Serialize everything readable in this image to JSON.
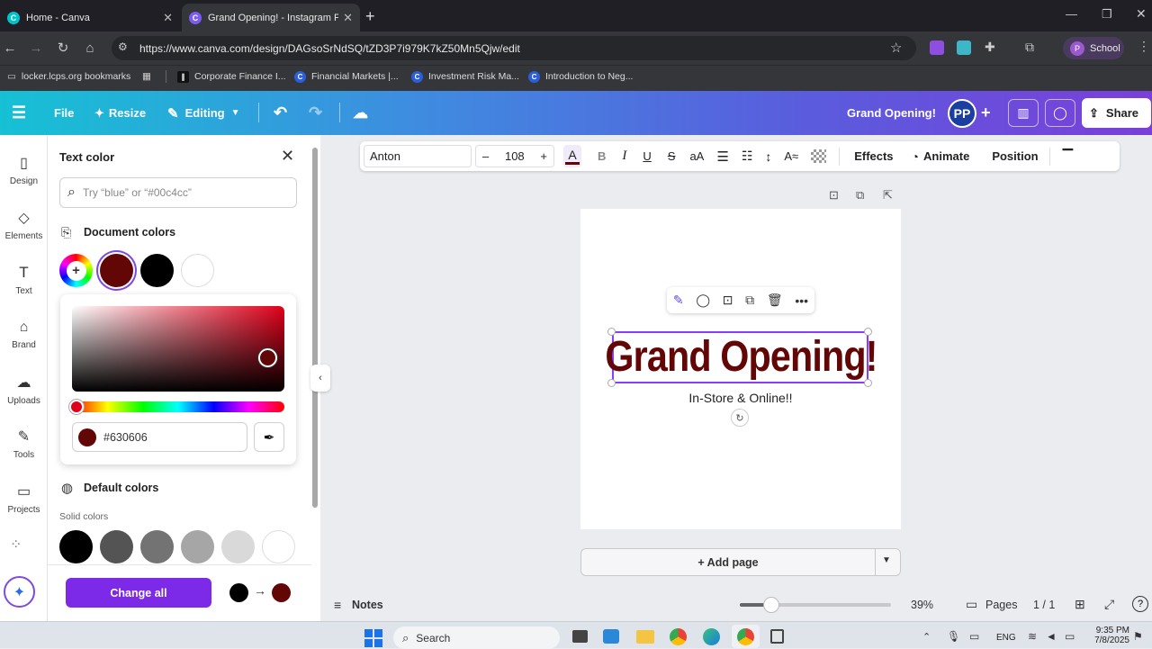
{
  "browser": {
    "tabs": [
      {
        "label": "Home - Canva",
        "close": "✕"
      },
      {
        "label": "Grand Opening! - Instagram Po",
        "close": "✕"
      }
    ],
    "new_tab": "+",
    "url": "https://www.canva.com/design/DAGsoSrNdSQ/tZD3P7i979K7kZ50Mn5Qjw/edit",
    "profile": "School",
    "profile_initial": "P",
    "bookmarks": [
      "locker.lcps.org bookmarks",
      "Corporate Finance I...",
      "Financial Markets |...",
      "Investment Risk Ma...",
      "Introduction to Neg..."
    ]
  },
  "topbar": {
    "file": "File",
    "resize": "Resize",
    "editing": "Editing",
    "title": "Grand Opening!",
    "avatar": "PP",
    "share": "Share"
  },
  "rail": [
    {
      "label": "Design",
      "icon": "panel-icon"
    },
    {
      "label": "Elements",
      "icon": "shapes-icon"
    },
    {
      "label": "Text",
      "icon": "text-icon"
    },
    {
      "label": "Brand",
      "icon": "brand-icon"
    },
    {
      "label": "Uploads",
      "icon": "cloud-upload-icon"
    },
    {
      "label": "Tools",
      "icon": "pen-icon"
    },
    {
      "label": "Projects",
      "icon": "folder-icon"
    }
  ],
  "panel": {
    "title": "Text color",
    "search_placeholder": "Try “blue” or “#00c4cc”",
    "doc_colors_heading": "Document colors",
    "doc_colors": [
      "#630606",
      "#000000",
      "#ffffff"
    ],
    "hex": "#630606",
    "default_heading": "Default colors",
    "solid_label": "Solid colors",
    "solid_colors": [
      "#000000",
      "#545454",
      "#737373",
      "#a6a6a6",
      "#d9d9d9",
      "#ffffff"
    ],
    "change_all": "Change all",
    "change_from": "#000000",
    "change_to": "#630606",
    "arrow": "→"
  },
  "toolbar": {
    "font": "Anton",
    "size": "108",
    "minus": "–",
    "plus": "+",
    "text_color_glyph": "A",
    "bold": "B",
    "italic": "I",
    "underline": "U",
    "strike": "S",
    "case": "aA",
    "effects": "Effects",
    "animate": "Animate",
    "position": "Position"
  },
  "canvas": {
    "headline": "Grand Opening!",
    "subtitle": "In-Store & Online!!",
    "add_page": "+ Add page"
  },
  "footer": {
    "notes": "Notes",
    "zoom": "39%",
    "zoom_fraction": 0.21,
    "pages": "Pages",
    "page_count": "1 / 1"
  },
  "taskbar": {
    "search": "Search",
    "lang": "ENG",
    "time": "9:35 PM",
    "date": "7/8/2025"
  }
}
